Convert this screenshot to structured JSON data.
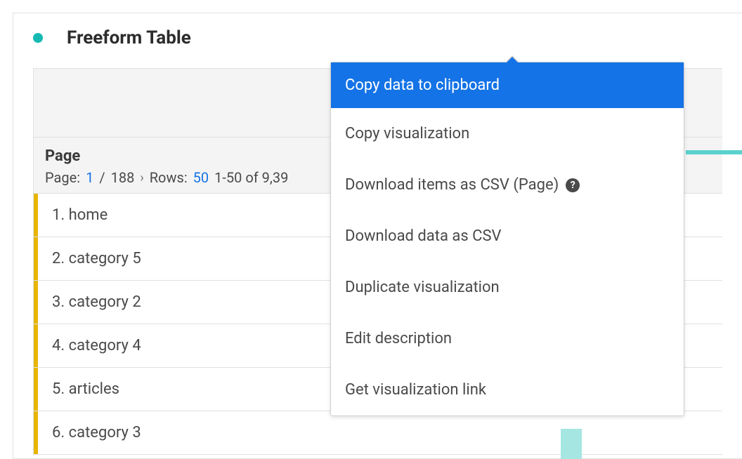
{
  "header": {
    "title": "Freeform Table"
  },
  "dimension": {
    "title": "Page",
    "pager": {
      "page_label": "Page:",
      "page_current": "1",
      "page_sep": "/",
      "page_total": "188",
      "rows_label": "Rows:",
      "rows_value": "50",
      "range_text": "1-50 of 9,39"
    }
  },
  "rows": [
    {
      "label": "1. home"
    },
    {
      "label": "2. category 5"
    },
    {
      "label": "3. category 2"
    },
    {
      "label": "4. category 4"
    },
    {
      "label": "5. articles"
    },
    {
      "label": "6. category 3"
    }
  ],
  "menu": {
    "items": [
      {
        "label": "Copy data to clipboard",
        "highlight": true
      },
      {
        "label": "Copy visualization"
      },
      {
        "label": "Download items as CSV (Page)",
        "help": true
      },
      {
        "label": "Download data as CSV"
      },
      {
        "label": "Duplicate visualization"
      },
      {
        "label": "Edit description"
      },
      {
        "label": "Get visualization link"
      }
    ],
    "help_glyph": "?"
  }
}
